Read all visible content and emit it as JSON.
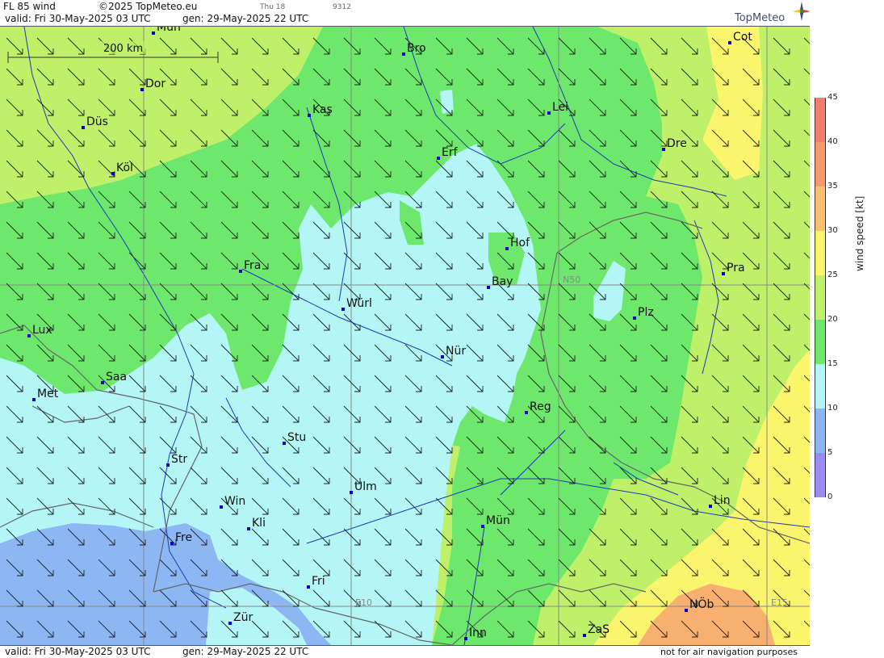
{
  "header": {
    "product": "FL 85 wind",
    "copyright": "©2025 TopMeteo.eu",
    "small_day": "Thu 18",
    "small_code": "9312",
    "valid": "valid:  Fri  30-May-2025  03 UTC",
    "gen": "gen: 29-May-2025 22 UTC",
    "brand": "TopMeteo"
  },
  "footer": {
    "valid": "valid:  Fri  30-May-2025  03 UTC",
    "gen": "gen: 29-May-2025 22 UTC",
    "disclaimer": "not for air navigation purposes"
  },
  "map": {
    "scale_label": "200 km",
    "grid_labels": {
      "lat": "N50",
      "lon1": "E10",
      "lon2": "E15"
    },
    "cities": [
      {
        "name": "Mün"
      },
      {
        "name": "Bro"
      },
      {
        "name": "Cot"
      },
      {
        "name": "Dor"
      },
      {
        "name": "Kas"
      },
      {
        "name": "Lei"
      },
      {
        "name": "Düs"
      },
      {
        "name": "Dre"
      },
      {
        "name": "Erf"
      },
      {
        "name": "Köl"
      },
      {
        "name": "Hof"
      },
      {
        "name": "Fra"
      },
      {
        "name": "Pra"
      },
      {
        "name": "Bay"
      },
      {
        "name": "Würl"
      },
      {
        "name": "Plz"
      },
      {
        "name": "Lux"
      },
      {
        "name": "Nür"
      },
      {
        "name": "Saa"
      },
      {
        "name": "Met"
      },
      {
        "name": "Reg"
      },
      {
        "name": "Stu"
      },
      {
        "name": "Str"
      },
      {
        "name": "Ulm"
      },
      {
        "name": "Win"
      },
      {
        "name": "Lin"
      },
      {
        "name": "Kli"
      },
      {
        "name": "Mün"
      },
      {
        "name": "Fre"
      },
      {
        "name": "Fri"
      },
      {
        "name": "NÖb"
      },
      {
        "name": "Zür"
      },
      {
        "name": "Inn"
      },
      {
        "name": "ZaS"
      }
    ]
  },
  "legend": {
    "title": "wind speed [kt]",
    "levels": [
      {
        "label": "45",
        "color": "#f07f6e"
      },
      {
        "label": "40",
        "color": "#f49a6e"
      },
      {
        "label": "35",
        "color": "#f8c070"
      },
      {
        "label": "30",
        "color": "#fbf56e"
      },
      {
        "label": "25",
        "color": "#bef06a"
      },
      {
        "label": "20",
        "color": "#6ee86c"
      },
      {
        "label": "15",
        "color": "#b4f6f5"
      },
      {
        "label": "10",
        "color": "#8cb7f2"
      },
      {
        "label": "5",
        "color": "#9a8cf2"
      },
      {
        "label": "0",
        "color": "#c888f0"
      }
    ]
  },
  "colors": {
    "wind30": "#fbf56e",
    "wind35": "#f8b070",
    "wind25": "#bef06a",
    "wind20": "#6ee86c",
    "wind15": "#b4f6f5",
    "wind10": "#8cb7f2",
    "river": "#1c3cb4",
    "border": "#666666",
    "city": "#0000cc"
  }
}
